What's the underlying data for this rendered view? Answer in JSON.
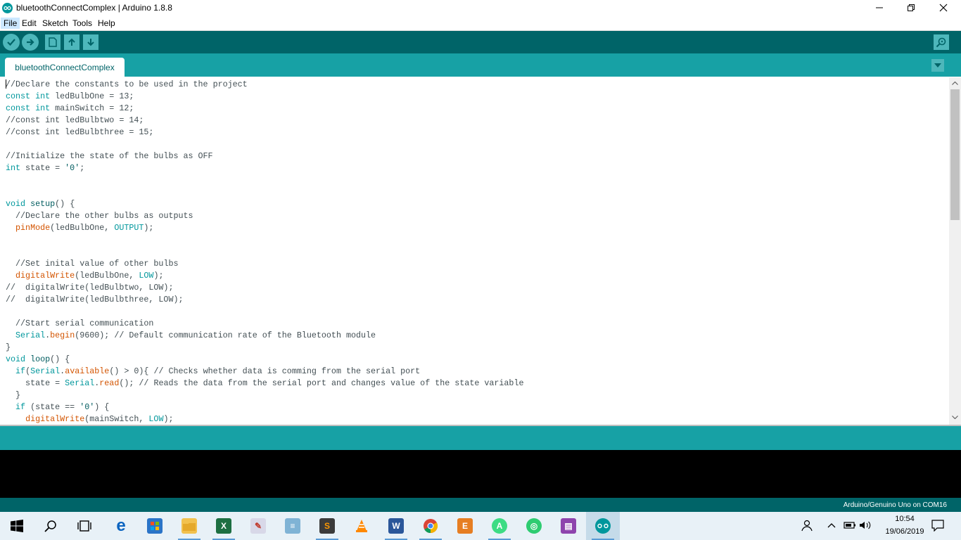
{
  "window": {
    "title": "bluetoothConnectComplex | Arduino 1.8.8"
  },
  "menu": {
    "items": [
      {
        "label": "File"
      },
      {
        "label": "Edit"
      },
      {
        "label": "Sketch"
      },
      {
        "label": "Tools"
      },
      {
        "label": "Help"
      }
    ]
  },
  "toolbar": {
    "icons": [
      "verify-icon",
      "upload-icon",
      "new-icon",
      "open-icon",
      "save-icon",
      "serial-monitor-icon"
    ]
  },
  "tabs": [
    {
      "label": "bluetoothConnectComplex"
    }
  ],
  "editor": {
    "lines": [
      "//Declare the constants to be used in the project",
      "const int ledBulbOne = 13;",
      "const int mainSwitch = 12;",
      "//const int ledBulbtwo = 14;",
      "//const int ledBulbthree = 15;",
      "",
      "//Initialize the state of the bulbs as OFF",
      "int state = '0';",
      "",
      "",
      "void setup() {",
      "  //Declare the other bulbs as outputs",
      "  pinMode(ledBulbOne, OUTPUT);",
      "",
      "",
      "  //Set inital value of other bulbs",
      "  digitalWrite(ledBulbOne, LOW);",
      "//  digitalWrite(ledBulbtwo, LOW);",
      "//  digitalWrite(ledBulbthree, LOW);",
      "",
      "  //Start serial communication",
      "  Serial.begin(9600); // Default communication rate of the Bluetooth module",
      "}",
      "void loop() {",
      "  if(Serial.available() > 0){ // Checks whether data is comming from the serial port",
      "    state = Serial.read(); // Reads the data from the serial port and changes value of the state variable",
      "  }",
      "  if (state == '0') {",
      "    digitalWrite(mainSwitch, LOW);"
    ]
  },
  "status": {
    "board": "Arduino/Genuino Uno on COM16"
  },
  "taskbar": {
    "apps": [
      "start-icon",
      "search-icon",
      "task-view-icon",
      "edge-icon",
      "store-icon",
      "file-explorer-icon",
      "excel-icon",
      "paint-icon",
      "notepad-icon",
      "sublime-icon",
      "vlc-icon",
      "word-icon",
      "chrome-icon",
      "e-app-icon",
      "android-studio-icon",
      "globe-app-icon",
      "winrar-icon",
      "arduino-icon"
    ],
    "time": "10:54",
    "date": "19/06/2019"
  },
  "colors": {
    "toolbar": "#006468",
    "tabstrip": "#17a1a5",
    "keyword": "#00979c",
    "function": "#d35400"
  }
}
